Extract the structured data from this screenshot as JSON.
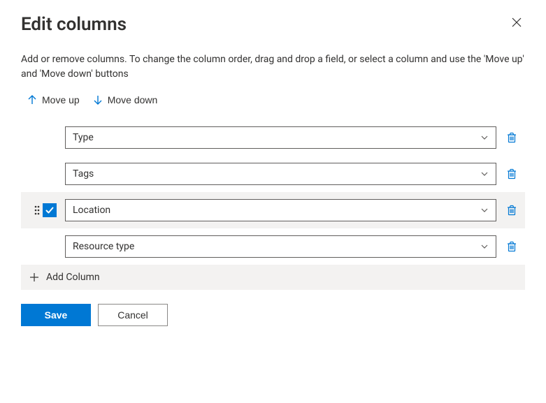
{
  "title": "Edit columns",
  "description": "Add or remove columns. To change the column order, drag and drop a field, or select a column and use the 'Move up' and 'Move down' buttons",
  "moveUp": "Move up",
  "moveDown": "Move down",
  "columns": [
    {
      "label": "Type",
      "selected": false
    },
    {
      "label": "Tags",
      "selected": false
    },
    {
      "label": "Location",
      "selected": true
    },
    {
      "label": "Resource type",
      "selected": false
    }
  ],
  "addColumn": "Add Column",
  "saveLabel": "Save",
  "cancelLabel": "Cancel"
}
